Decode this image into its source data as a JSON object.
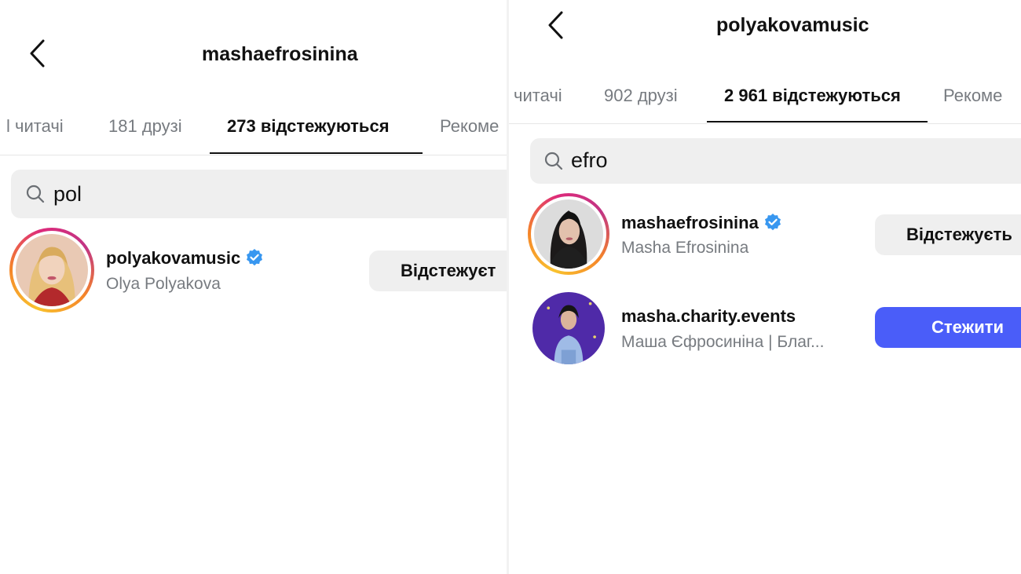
{
  "left": {
    "title": "mashaefrosinina",
    "tabs": [
      "l читачі",
      "181 друзі",
      "273 відстежуються",
      "Рекоме"
    ],
    "active_tab": 2,
    "search": {
      "value": "pol"
    },
    "results": [
      {
        "username": "polyakovamusic",
        "verified": true,
        "full_name": "Olya Polyakova",
        "button_label": "Відстежуєт",
        "button_style": "grey",
        "story_ring": true
      }
    ]
  },
  "right": {
    "title": "polyakovamusic",
    "tabs": [
      "читачі",
      "902 друзі",
      "2 961 відстежуються",
      "Рекоме"
    ],
    "active_tab": 2,
    "search": {
      "value": "efro"
    },
    "results": [
      {
        "username": "mashaefrosinina",
        "verified": true,
        "full_name": "Masha Efrosinina",
        "button_label": "Відстежуєть",
        "button_style": "grey",
        "story_ring": true
      },
      {
        "username": "masha.charity.events",
        "verified": false,
        "full_name": "Маша Єфросиніна | Благ...",
        "button_label": "Стежити",
        "button_style": "blue",
        "story_ring": false
      }
    ]
  },
  "icons": {
    "back": "chevron-left-icon",
    "search": "search-icon",
    "verified": "verified-badge-icon"
  },
  "colors": {
    "accent_blue": "#4a5df9",
    "verified_blue": "#3897f0",
    "muted_text": "#777b80",
    "search_bg": "#efefef"
  }
}
